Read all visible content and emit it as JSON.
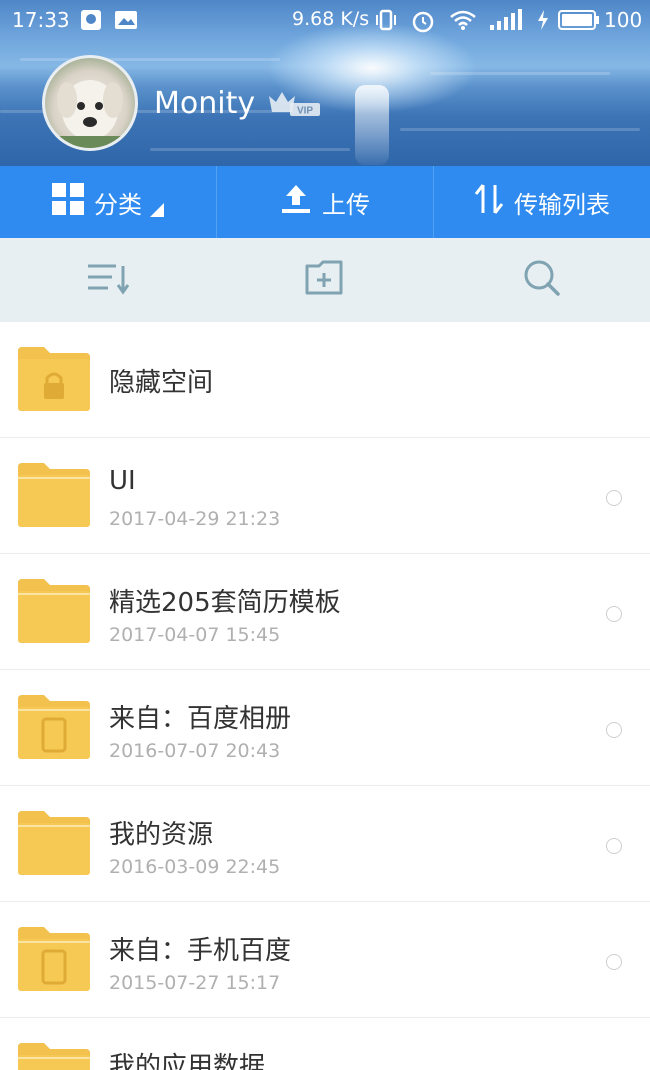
{
  "status_bar": {
    "time": "17:33",
    "speed": "9.68 K/s",
    "battery": "100"
  },
  "profile": {
    "username": "Monity",
    "vip_badge": "VIP"
  },
  "actions": [
    {
      "label": "分类",
      "icon": "grid-icon"
    },
    {
      "label": "上传",
      "icon": "upload-icon"
    },
    {
      "label": "传输列表",
      "icon": "transfer-icon"
    }
  ],
  "toolbar": {
    "sort_icon": "sort-icon",
    "new_folder_icon": "new-folder-icon",
    "search_icon": "search-icon"
  },
  "files": [
    {
      "name": "隐藏空间",
      "date": "",
      "type": "locked-folder"
    },
    {
      "name": "UI",
      "date": "2017-04-29  21:23",
      "type": "folder"
    },
    {
      "name": "精选205套简历模板",
      "date": "2017-04-07  15:45",
      "type": "folder"
    },
    {
      "name": "来自：百度相册",
      "date": "2016-07-07  20:43",
      "type": "device-folder"
    },
    {
      "name": "我的资源",
      "date": "2016-03-09  22:45",
      "type": "folder"
    },
    {
      "name": "来自：手机百度",
      "date": "2015-07-27  15:17",
      "type": "device-folder"
    },
    {
      "name": "我的应用数据",
      "date": "",
      "type": "folder"
    }
  ],
  "colors": {
    "accent": "#2f8bf0",
    "folder": "#f2c14e",
    "toolbar_bg": "#e8eff2"
  }
}
